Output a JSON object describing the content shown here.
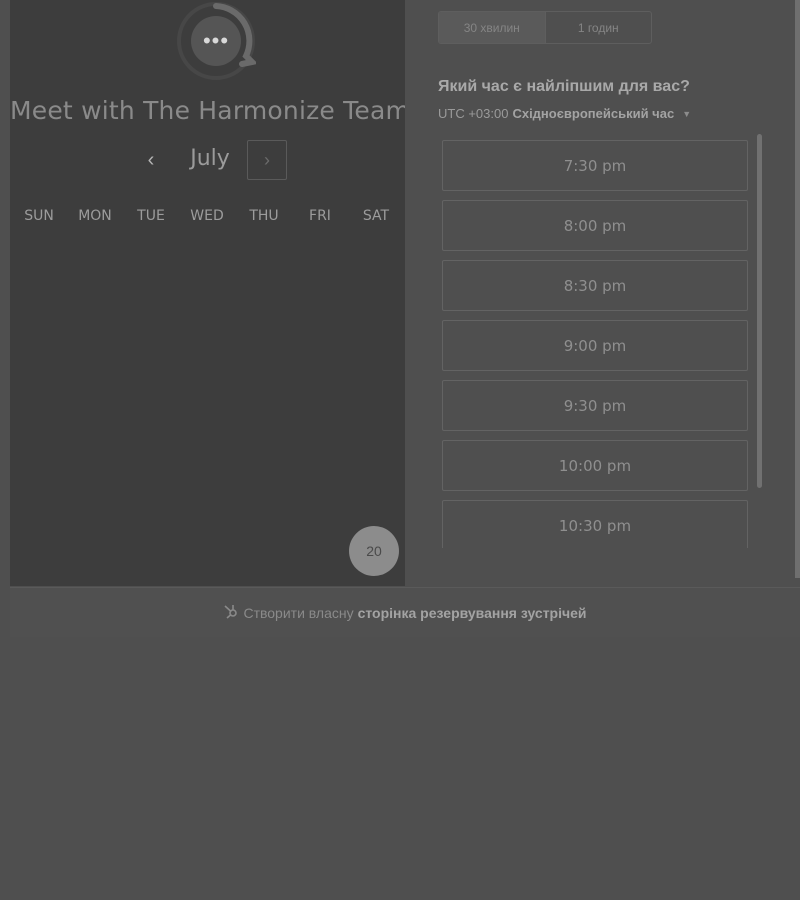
{
  "scheduler": {
    "title": "Meet with The Harmonize Team",
    "avatar_icon": "chat-bubble-dots",
    "month": "July",
    "prev_symbol": "‹",
    "next_symbol": "›",
    "weekdays": [
      "SUN",
      "MON",
      "TUE",
      "WED",
      "THU",
      "FRI",
      "SAT"
    ],
    "selected_date": "20"
  },
  "durations": {
    "tabs": [
      "30 хвилин",
      "1 годин"
    ],
    "active_index": 0
  },
  "times": {
    "question": "Який час є найліпшим для вас?",
    "timezone_offset": "UTC +03:00",
    "timezone_name": "Східноєвропейський час",
    "slots": [
      "7:30 pm",
      "8:00 pm",
      "8:30 pm",
      "9:00 pm",
      "9:30 pm",
      "10:00 pm",
      "10:30 pm"
    ]
  },
  "footer": {
    "icon": "hubspot-sprocket-icon",
    "text": "Створити власну",
    "link_text": "сторінка резервування зустрічей"
  },
  "colors": {
    "background": "#4f4f4f",
    "left_panel": "#3d3d3d",
    "selected_date_fill": "#8c8c8c"
  }
}
